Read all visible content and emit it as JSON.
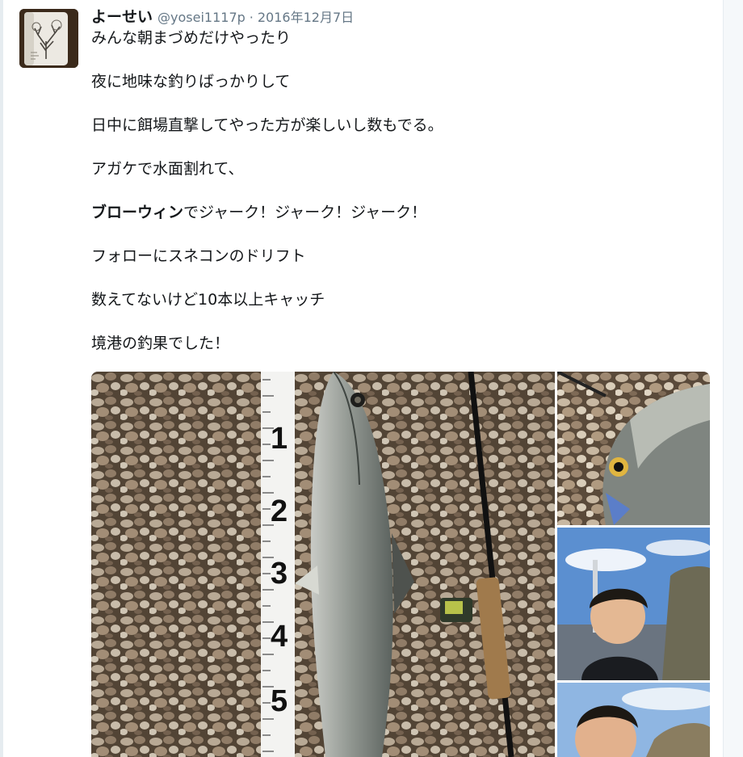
{
  "tweet": {
    "display_name": "よーせい",
    "handle": "@yosei1117p",
    "separator": "·",
    "date": "2016年12月7日",
    "lines": [
      "みんな朝まづめだけやったり",
      "夜に地味な釣りばっかりして",
      "日中に餌場直撃してやった方が楽しいし数もでる。",
      "アガケで水面割れて、",
      {
        "bold": "ブローウィン",
        "rest": "でジャーク！ジャーク！ジャーク！"
      },
      "フォローにスネコンのドリフト",
      "数えてないけど10本以上キャッチ",
      "境港の釣果でした！"
    ]
  },
  "media": {
    "photos": [
      {
        "name": "fish-on-shells-with-measuring-tape",
        "ruler_digits": [
          "1",
          "2",
          "3",
          "4",
          "5"
        ]
      },
      {
        "name": "fish-head-closeup"
      },
      {
        "name": "angler-selfie-with-fish"
      },
      {
        "name": "angler-portrait"
      }
    ]
  },
  "colors": {
    "text": "#14171a",
    "muted": "#657786",
    "border": "#e6ecf0"
  }
}
